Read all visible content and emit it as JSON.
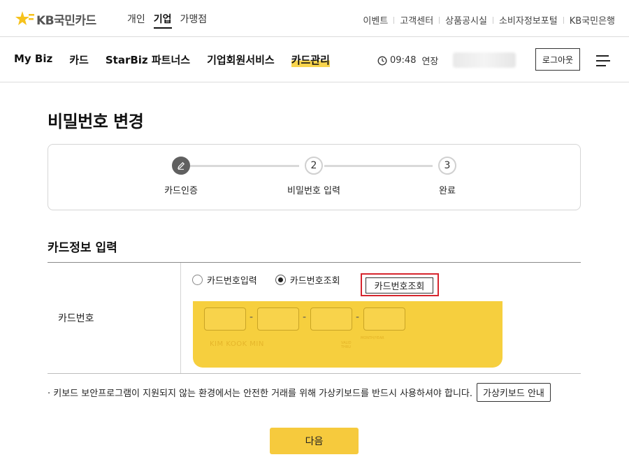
{
  "brand": {
    "logo_text": "KB국민카드",
    "accent_color": "#f6ca3d"
  },
  "topbar": {
    "audience": [
      "개인",
      "기업",
      "가맹점"
    ],
    "audience_active": "기업",
    "util_links": [
      "이벤트",
      "고객센터",
      "상품공시실",
      "소비자정보포털",
      "KB국민은행"
    ]
  },
  "nav": {
    "items": [
      "My Biz",
      "카드",
      "StarBiz 파트너스",
      "기업회원서비스",
      "카드관리"
    ],
    "active": "카드관리",
    "session_time": "09:48",
    "extend_label": "연장",
    "logout_label": "로그아웃"
  },
  "page": {
    "title": "비밀번호 변경"
  },
  "stepper": {
    "steps": [
      {
        "num": "",
        "label": "카드인증",
        "state": "done"
      },
      {
        "num": "2",
        "label": "비밀번호 입력",
        "state": "todo"
      },
      {
        "num": "3",
        "label": "완료",
        "state": "todo"
      }
    ]
  },
  "form": {
    "section_title": "카드정보 입력",
    "row_label": "카드번호",
    "radio_options": [
      "카드번호입력",
      "카드번호조회"
    ],
    "radio_selected": "카드번호조회",
    "lookup_button": "카드번호조회",
    "card_holder": "KIM KOOK MIN",
    "card_valid_label_1": "VALID",
    "card_valid_label_2": "THRU",
    "card_month_year": "MONTH/YEAR",
    "card_number_boxes": [
      "",
      "",
      "",
      ""
    ]
  },
  "notice": {
    "text": "· 키보드 보안프로그램이 지원되지 않는 환경에서는 안전한 거래를 위해 가상키보드를 반드시 사용하셔야 합니다.",
    "vkb_button": "가상키보드 안내"
  },
  "actions": {
    "next_label": "다음"
  }
}
